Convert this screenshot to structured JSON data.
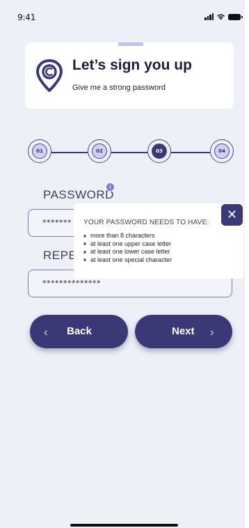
{
  "status_bar": {
    "time": "9:41"
  },
  "header": {
    "title": "Let’s sign you up",
    "subtitle": "Give me a strong password"
  },
  "stepper": {
    "steps": [
      "01",
      "02",
      "03",
      "04"
    ],
    "active_step": "03"
  },
  "form": {
    "password_label": "PASSWORD",
    "password_value": "*******",
    "repeat_label": "REPEA",
    "repeat_value": "**************"
  },
  "tooltip": {
    "title": "YOUR PASSWORD NEEDS TO HAVE:",
    "requirements": [
      "more than 8 characters",
      "at least one upper case letter",
      "at least one lower case letter",
      "at least one special character"
    ],
    "close_label": "✕"
  },
  "buttons": {
    "back_label": "Back",
    "next_label": "Next"
  },
  "colors": {
    "primary": "#3b3876",
    "accent": "#8277e0",
    "background": "#eef0f7",
    "step_fill": "#d2cff5"
  },
  "icons": [
    "signal-icon",
    "wifi-icon",
    "battery-icon",
    "location-pin-logo-icon",
    "info-icon",
    "close-icon",
    "chevron-left-icon",
    "chevron-right-icon"
  ]
}
